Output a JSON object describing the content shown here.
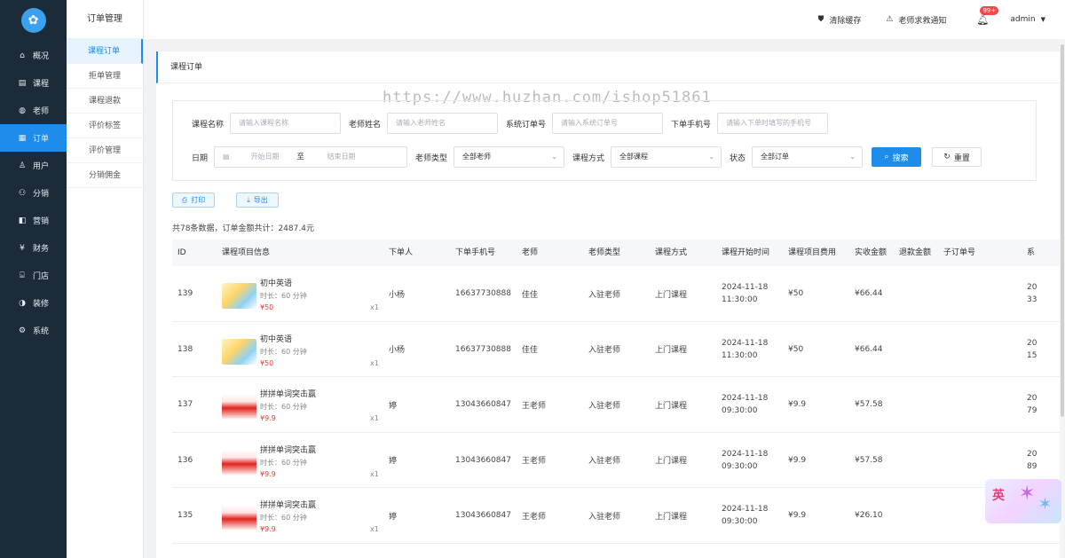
{
  "sidebar": {
    "items": [
      {
        "label": "概况",
        "icon": "home-icon",
        "glyph": "⌂"
      },
      {
        "label": "课程",
        "icon": "course-icon",
        "glyph": "▤"
      },
      {
        "label": "老师",
        "icon": "teacher-icon",
        "glyph": "◍"
      },
      {
        "label": "订单",
        "icon": "order-icon",
        "glyph": "▦"
      },
      {
        "label": "用户",
        "icon": "user-icon",
        "glyph": "♙"
      },
      {
        "label": "分销",
        "icon": "share-icon",
        "glyph": "⚇"
      },
      {
        "label": "营销",
        "icon": "marketing-icon",
        "glyph": "◧"
      },
      {
        "label": "财务",
        "icon": "finance-icon",
        "glyph": "¥"
      },
      {
        "label": "门店",
        "icon": "store-icon",
        "glyph": "⌸"
      },
      {
        "label": "装修",
        "icon": "decorate-icon",
        "glyph": "◑"
      },
      {
        "label": "系统",
        "icon": "settings-icon",
        "glyph": "⚙"
      }
    ]
  },
  "subnav": {
    "title": "订单管理",
    "items": [
      "课程订单",
      "拒单管理",
      "课程退款",
      "评价标签",
      "评价管理",
      "分销佣金"
    ]
  },
  "topbar": {
    "clear_cache": "清除缓存",
    "teacher_notice": "老师求救通知",
    "badge": "99+",
    "user": "admin"
  },
  "page": {
    "title": "课程订单",
    "watermark": "https://www.huzhan.com/ishop51861"
  },
  "filters": {
    "course_name_label": "课程名称",
    "course_name_placeholder": "请输入课程名称",
    "teacher_name_label": "老师姓名",
    "teacher_name_placeholder": "请输入老师姓名",
    "order_no_label": "系统订单号",
    "order_no_placeholder": "请输入系统订单号",
    "phone_label": "下单手机号",
    "phone_placeholder": "请输入下单时填写的手机号",
    "date_label": "日期",
    "start_placeholder": "开始日期",
    "to": "至",
    "end_placeholder": "结束日期",
    "teacher_type_label": "老师类型",
    "teacher_type_value": "全部老师",
    "course_mode_label": "课程方式",
    "course_mode_value": "全部课程",
    "status_label": "状态",
    "status_value": "全部订单",
    "search": "搜索",
    "reset": "重置"
  },
  "actions": {
    "print": "打印",
    "export": "导出"
  },
  "summary": "共78条数据，订单金额共计：2487.4元",
  "table": {
    "headers": [
      "ID",
      "课程项目信息",
      "下单人",
      "下单手机号",
      "老师",
      "老师类型",
      "课程方式",
      "课程开始时间",
      "课程项目费用",
      "实收金额",
      "退款金额",
      "子订单号",
      "系"
    ],
    "rows": [
      {
        "id": "139",
        "thumb": "en",
        "course": "初中英语",
        "duration": "时长：60 分钟",
        "price": "¥50",
        "qty": "x1",
        "buyer": "小杨",
        "phone": "16637730888",
        "teacher": "佳佳",
        "teacher_type": "入驻老师",
        "mode": "上门课程",
        "date": "2024-11-18",
        "time": "11:30:00",
        "fee": "¥50",
        "paid": "¥66.44",
        "sys1": "20",
        "sys2": "33"
      },
      {
        "id": "138",
        "thumb": "en",
        "course": "初中英语",
        "duration": "时长：60 分钟",
        "price": "¥50",
        "qty": "x1",
        "buyer": "小杨",
        "phone": "16637730888",
        "teacher": "佳佳",
        "teacher_type": "入驻老师",
        "mode": "上门课程",
        "date": "2024-11-18",
        "time": "11:30:00",
        "fee": "¥50",
        "paid": "¥66.44",
        "sys1": "20",
        "sys2": "15"
      },
      {
        "id": "137",
        "thumb": "cn",
        "course": "拼拼单词突击赢",
        "duration": "时长：60 分钟",
        "price": "¥9.9",
        "qty": "x1",
        "buyer": "婷",
        "phone": "13043660847",
        "teacher": "王老师",
        "teacher_type": "入驻老师",
        "mode": "上门课程",
        "date": "2024-11-18",
        "time": "09:30:00",
        "fee": "¥9.9",
        "paid": "¥57.58",
        "sys1": "20",
        "sys2": "79"
      },
      {
        "id": "136",
        "thumb": "cn",
        "course": "拼拼单词突击赢",
        "duration": "时长：60 分钟",
        "price": "¥9.9",
        "qty": "x1",
        "buyer": "婷",
        "phone": "13043660847",
        "teacher": "王老师",
        "teacher_type": "入驻老师",
        "mode": "上门课程",
        "date": "2024-11-18",
        "time": "09:30:00",
        "fee": "¥9.9",
        "paid": "¥57.58",
        "sys1": "20",
        "sys2": "89"
      },
      {
        "id": "135",
        "thumb": "cn",
        "course": "拼拼单词突击赢",
        "duration": "时长：60 分钟",
        "price": "¥9.9",
        "qty": "x1",
        "buyer": "婷",
        "phone": "13043660847",
        "teacher": "王老师",
        "teacher_type": "入驻老师",
        "mode": "上门课程",
        "date": "2024-11-18",
        "time": "09:30:00",
        "fee": "¥9.9",
        "paid": "¥26.10",
        "sys1": "20",
        "sys2": "78"
      }
    ]
  },
  "float_widget": "英",
  "colors": {
    "primary": "#1d8ceb",
    "sidebar": "#1c2b3a",
    "price": "#e53935"
  }
}
